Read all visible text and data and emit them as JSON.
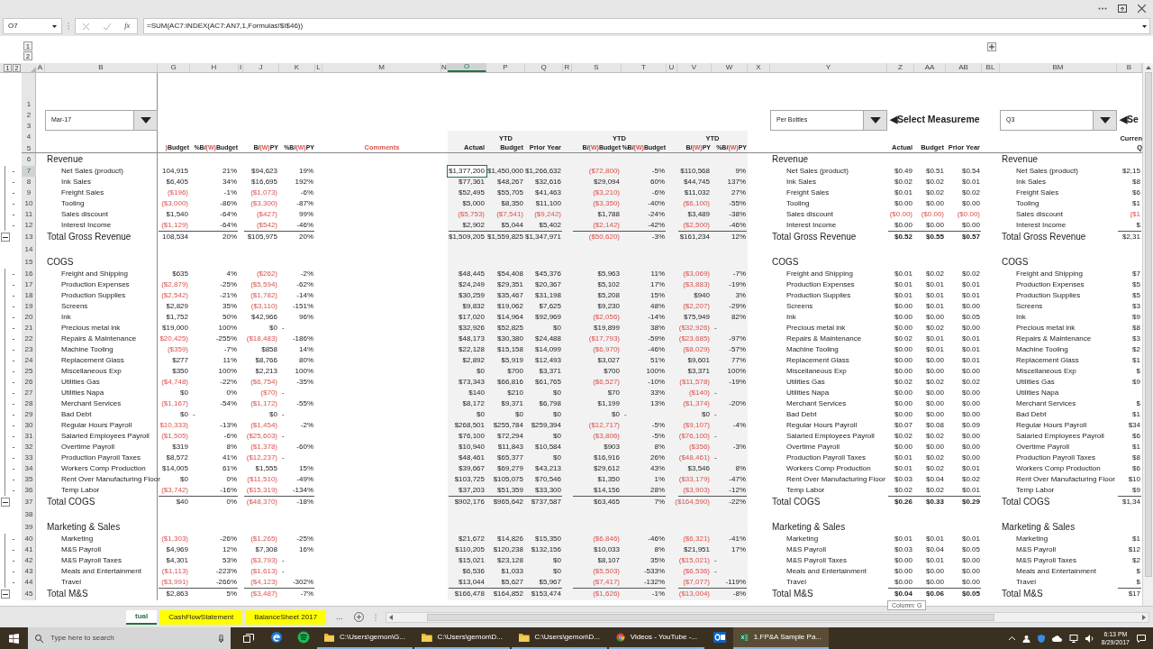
{
  "name_box": "O7",
  "function_label": "fx",
  "formula": "=SUM(AC7:INDEX(AC7:AN7,1,Formulas!$I$46))",
  "row_outline_levels": [
    "1",
    "2"
  ],
  "column_outline_levels": [
    "1",
    "2"
  ],
  "columns": [
    {
      "label": "A",
      "selected": false
    },
    {
      "label": "B",
      "selected": false
    },
    {
      "label": "G",
      "selected": false
    },
    {
      "label": "H",
      "selected": false
    },
    {
      "label": "I",
      "selected": false
    },
    {
      "label": "J",
      "selected": false
    },
    {
      "label": "K",
      "selected": false
    },
    {
      "label": "L",
      "selected": false
    },
    {
      "label": "M",
      "selected": false
    },
    {
      "label": "N",
      "selected": false
    },
    {
      "label": "O",
      "selected": true
    },
    {
      "label": "P",
      "selected": false
    },
    {
      "label": "Q",
      "selected": false
    },
    {
      "label": "R",
      "selected": false
    },
    {
      "label": "S",
      "selected": false
    },
    {
      "label": "T",
      "selected": false
    },
    {
      "label": "U",
      "selected": false
    },
    {
      "label": "V",
      "selected": false
    },
    {
      "label": "W",
      "selected": false
    },
    {
      "label": "X",
      "selected": false
    },
    {
      "label": "Y",
      "selected": false
    },
    {
      "label": "Z",
      "selected": false
    },
    {
      "label": "AA",
      "selected": false
    },
    {
      "label": "AB",
      "selected": false
    },
    {
      "label": "BL",
      "selected": false
    },
    {
      "label": "BM",
      "selected": false
    },
    {
      "label": "B",
      "selected": false
    }
  ],
  "filters": {
    "period": "Mar-17",
    "measure": "Per Bottles",
    "measure_hint": "◀Select Measureme",
    "quarter": "Q3",
    "quarter_hint": "◀Se"
  },
  "top_row_numbers": [
    "1",
    "2",
    "3",
    "4",
    "5"
  ],
  "header": {
    "ytd_labels": [
      "YTD",
      "YTD",
      "YTD"
    ],
    "quarter_top": "Curren",
    "month_columns": [
      [
        {
          "t": ")",
          "red": true
        },
        {
          "t": " Budget"
        }
      ],
      [
        {
          "t": "%B/"
        },
        {
          "t": "(W)",
          "red": true
        },
        {
          "t": " Budget"
        }
      ],
      [
        {
          "t": "B/"
        },
        {
          "t": "(W)",
          "red": true
        },
        {
          "t": " PY"
        }
      ],
      [
        {
          "t": "%B/"
        },
        {
          "t": "(W)",
          "red": true
        },
        {
          "t": " PY"
        }
      ]
    ],
    "comments": "Comments",
    "ytd_columns": [
      "Actual",
      "Budget",
      "Prior Year"
    ],
    "variance_columns": [
      [
        {
          "t": "B/"
        },
        {
          "t": "(W)",
          "red": true
        },
        {
          "t": " Budget"
        }
      ],
      [
        {
          "t": "%B/"
        },
        {
          "t": "(W)",
          "red": true
        },
        {
          "t": " Budget"
        }
      ],
      [
        {
          "t": "B/"
        },
        {
          "t": "(W)",
          "red": true
        },
        {
          "t": " PY"
        }
      ],
      [
        {
          "t": "%B/"
        },
        {
          "t": "(W)",
          "red": true
        },
        {
          "t": " PY"
        }
      ]
    ],
    "per_unit_columns": [
      "Actual",
      "Budget",
      "Prior Year"
    ],
    "quarter_column": "Q"
  },
  "rows": [
    {
      "n": "6",
      "kind": "section",
      "labels": [
        "Revenue",
        "Revenue",
        "Revenue"
      ]
    },
    {
      "n": "7",
      "kind": "item",
      "labels": [
        "Net Sales (product)",
        "Net Sales (product)",
        "Net Sales (product)"
      ],
      "month": [
        "104,915",
        "21%",
        "$94,623",
        "19%"
      ],
      "ytd": [
        "$1,377,200",
        "$1,450,000",
        "$1,266,632"
      ],
      "ytd_selected": [
        true,
        false,
        false
      ],
      "variance": [
        {
          "v": "($72,800)",
          "neg": true
        },
        "-5%",
        "$110,568",
        "9%"
      ],
      "per_unit": [
        "$0.49",
        "$0.51",
        "$0.54"
      ],
      "quarter": "$2,15"
    },
    {
      "n": "8",
      "kind": "item",
      "labels": [
        "Ink Sales",
        "Ink Sales",
        "Ink Sales"
      ],
      "month": [
        "$6,405",
        "34%",
        "$16,695",
        "192%"
      ],
      "ytd": [
        "$77,361",
        "$48,267",
        "$32,616"
      ],
      "variance": [
        "$29,094",
        "60%",
        "$44,745",
        "137%"
      ],
      "per_unit": [
        "$0.02",
        "$0.02",
        "$0.01"
      ],
      "quarter": "$8"
    },
    {
      "n": "9",
      "kind": "item",
      "labels": [
        "Freight Sales",
        "Freight Sales",
        "Freight Sales"
      ],
      "month": [
        {
          "v": "($196)",
          "neg": true
        },
        "-1%",
        {
          "v": "($1,073)",
          "neg": true
        },
        "-6%"
      ],
      "ytd": [
        "$52,495",
        "$55,705",
        "$41,463"
      ],
      "variance": [
        {
          "v": "($3,210)",
          "neg": true
        },
        "-6%",
        "$11,032",
        "27%"
      ],
      "per_unit": [
        "$0.01",
        "$0.02",
        "$0.02"
      ],
      "quarter": "$6"
    },
    {
      "n": "10",
      "kind": "item",
      "labels": [
        "Tooling",
        "Tooling",
        "Tooling"
      ],
      "month": [
        {
          "v": "($3,000)",
          "neg": true
        },
        "-86%",
        {
          "v": "($3,300)",
          "neg": true
        },
        "-87%"
      ],
      "ytd": [
        "$5,000",
        "$8,350",
        "$11,100"
      ],
      "variance": [
        {
          "v": "($3,350)",
          "neg": true
        },
        "-40%",
        {
          "v": "($6,100)",
          "neg": true
        },
        "-55%"
      ],
      "per_unit": [
        "$0.00",
        "$0.00",
        "$0.00"
      ],
      "quarter": "$1"
    },
    {
      "n": "11",
      "kind": "item",
      "labels": [
        "Sales discount",
        "Sales discount",
        "Sales discount"
      ],
      "month": [
        "$1,540",
        "-64%",
        {
          "v": "($427)",
          "neg": true
        },
        "99%"
      ],
      "ytd": [
        {
          "v": "($5,753)",
          "neg": true
        },
        {
          "v": "($7,541)",
          "neg": true
        },
        {
          "v": "($9,242)",
          "neg": true
        }
      ],
      "variance": [
        "$1,788",
        "-24%",
        "$3,489",
        "-38%"
      ],
      "per_unit": [
        {
          "v": "($0.00)",
          "neg": true
        },
        {
          "v": "($0.00)",
          "neg": true
        },
        {
          "v": "($0.00)",
          "neg": true
        }
      ],
      "quarter": {
        "v": "($1",
        "neg": true
      }
    },
    {
      "n": "12",
      "kind": "item",
      "labels": [
        "Interest Income",
        "Interest Income",
        "Interest Income"
      ],
      "month": [
        {
          "v": "($1,129)",
          "neg": true
        },
        "-64%",
        {
          "v": "($542)",
          "neg": true
        },
        "-46%"
      ],
      "ytd": [
        "$2,902",
        "$5,044",
        "$5,402"
      ],
      "variance": [
        {
          "v": "($2,142)",
          "neg": true
        },
        "-42%",
        {
          "v": "($2,500)",
          "neg": true
        },
        "-46%"
      ],
      "per_unit": [
        "$0.00",
        "$0.00",
        "$0.00"
      ],
      "quarter": "$"
    },
    {
      "n": "13",
      "kind": "total",
      "labels": [
        "Total Gross Revenue",
        "Total Gross Revenue",
        "Total Gross Revenue"
      ],
      "month": [
        "108,534",
        "20%",
        "$105,975",
        "20%"
      ],
      "ytd": [
        "$1,509,205",
        "$1,559,825",
        "$1,347,971"
      ],
      "variance": [
        {
          "v": "($50,620)",
          "neg": true
        },
        "-3%",
        "$161,234",
        "12%"
      ],
      "per_unit": [
        "$0.52",
        "$0.55",
        "$0.57"
      ],
      "quarter": "$2,31"
    },
    {
      "n": "14",
      "kind": "blank"
    },
    {
      "n": "15",
      "kind": "section",
      "labels": [
        "COGS",
        "COGS",
        "COGS"
      ]
    },
    {
      "n": "16",
      "kind": "item",
      "labels": [
        "Freight and Shipping",
        "Freight and Shipping",
        "Freight and Shipping"
      ],
      "month": [
        "$635",
        "4%",
        {
          "v": "($262)",
          "neg": true
        },
        "-2%"
      ],
      "ytd": [
        "$48,445",
        "$54,408",
        "$45,376"
      ],
      "variance": [
        "$5,963",
        "11%",
        {
          "v": "($3,069)",
          "neg": true
        },
        "-7%"
      ],
      "per_unit": [
        "$0.01",
        "$0.02",
        "$0.02"
      ],
      "quarter": "$7"
    },
    {
      "n": "17",
      "kind": "item",
      "labels": [
        "Production Expenses",
        "Production Expenses",
        "Production Expenses"
      ],
      "month": [
        {
          "v": "($2,879)",
          "neg": true
        },
        "-25%",
        {
          "v": "($5,594)",
          "neg": true
        },
        "-62%"
      ],
      "ytd": [
        "$24,249",
        "$29,351",
        "$20,367"
      ],
      "variance": [
        "$5,102",
        "17%",
        {
          "v": "($3,883)",
          "neg": true
        },
        "-19%"
      ],
      "per_unit": [
        "$0.01",
        "$0.01",
        "$0.01"
      ],
      "quarter": "$5"
    },
    {
      "n": "18",
      "kind": "item",
      "labels": [
        "Production Supplies",
        "Production Supplies",
        "Production Supplies"
      ],
      "month": [
        {
          "v": "($2,542)",
          "neg": true
        },
        "-21%",
        {
          "v": "($1,782)",
          "neg": true
        },
        "-14%"
      ],
      "ytd": [
        "$30,259",
        "$35,467",
        "$31,198"
      ],
      "variance": [
        "$5,208",
        "15%",
        "$940",
        "3%"
      ],
      "per_unit": [
        "$0.01",
        "$0.01",
        "$0.01"
      ],
      "quarter": "$5"
    },
    {
      "n": "19",
      "kind": "item",
      "labels": [
        "Screens",
        "Screens",
        "Screens"
      ],
      "month": [
        "$2,829",
        "35%",
        {
          "v": "($3,110)",
          "neg": true
        },
        "-151%"
      ],
      "ytd": [
        "$9,832",
        "$19,062",
        "$7,625"
      ],
      "variance": [
        "$9,230",
        "48%",
        {
          "v": "($2,207)",
          "neg": true
        },
        "-29%"
      ],
      "per_unit": [
        "$0.00",
        "$0.01",
        "$0.00"
      ],
      "quarter": "$3"
    },
    {
      "n": "20",
      "kind": "item",
      "labels": [
        "Ink",
        "Ink",
        "Ink"
      ],
      "month": [
        "$1,752",
        "50%",
        "$42,966",
        "96%"
      ],
      "ytd": [
        "$17,020",
        "$14,964",
        "$92,969"
      ],
      "variance": [
        {
          "v": "($2,056)",
          "neg": true
        },
        "-14%",
        "$75,949",
        "82%"
      ],
      "per_unit": [
        "$0.00",
        "$0.00",
        "$0.05"
      ],
      "quarter": "$9"
    },
    {
      "n": "21",
      "kind": "item",
      "labels": [
        "Precious metal ink",
        "Precious metal ink",
        "Precious metal ink"
      ],
      "month": [
        "$19,000",
        "100%",
        "$0",
        {
          "v": "-",
          "kind": "dash"
        }
      ],
      "ytd": [
        "$32,926",
        "$52,825",
        "$0"
      ],
      "variance": [
        "$19,899",
        "38%",
        {
          "v": "($32,926)",
          "neg": true
        },
        {
          "v": "-",
          "kind": "dash"
        }
      ],
      "per_unit": [
        "$0.00",
        "$0.02",
        "$0.00"
      ],
      "quarter": "$8"
    },
    {
      "n": "22",
      "kind": "item",
      "labels": [
        "Repairs & Maintenance",
        "Repairs & Maintenance",
        "Repairs & Maintenance"
      ],
      "month": [
        {
          "v": "$20,425)",
          "neg": true
        },
        "-255%",
        {
          "v": "($18,483)",
          "neg": true
        },
        "-186%"
      ],
      "ytd": [
        "$48,173",
        "$30,380",
        "$24,488"
      ],
      "variance": [
        {
          "v": "($17,793)",
          "neg": true
        },
        "-59%",
        {
          "v": "($23,685)",
          "neg": true
        },
        "-97%"
      ],
      "per_unit": [
        "$0.02",
        "$0.01",
        "$0.01"
      ],
      "quarter": "$3"
    },
    {
      "n": "23",
      "kind": "item",
      "labels": [
        "Machine Tooling",
        "Machine Tooling",
        "Machine Tooling"
      ],
      "month": [
        {
          "v": "($359)",
          "neg": true
        },
        "-7%",
        "$858",
        "14%"
      ],
      "ytd": [
        "$22,128",
        "$15,158",
        "$14,099"
      ],
      "variance": [
        {
          "v": "($6,970)",
          "neg": true
        },
        "-46%",
        {
          "v": "($8,029)",
          "neg": true
        },
        "-57%"
      ],
      "per_unit": [
        "$0.00",
        "$0.01",
        "$0.01"
      ],
      "quarter": "$2"
    },
    {
      "n": "24",
      "kind": "item",
      "labels": [
        "Replacement Glass",
        "Replacement Glass",
        "Replacement Glass"
      ],
      "month": [
        "$277",
        "11%",
        "$8,766",
        "80%"
      ],
      "ytd": [
        "$2,892",
        "$5,919",
        "$12,493"
      ],
      "variance": [
        "$3,027",
        "51%",
        "$9,601",
        "77%"
      ],
      "per_unit": [
        "$0.00",
        "$0.00",
        "$0.01"
      ],
      "quarter": "$1"
    },
    {
      "n": "25",
      "kind": "item",
      "labels": [
        "Miscellaneous Exp",
        "Miscellaneous Exp",
        "Miscellaneous Exp"
      ],
      "month": [
        "$350",
        "100%",
        "$2,213",
        "100%"
      ],
      "ytd": [
        "$0",
        "$700",
        "$3,371"
      ],
      "variance": [
        "$700",
        "100%",
        "$3,371",
        "100%"
      ],
      "per_unit": [
        "$0.00",
        "$0.00",
        "$0.00"
      ],
      "quarter": "$"
    },
    {
      "n": "26",
      "kind": "item",
      "labels": [
        "Utilities Gas",
        "Utilities Gas",
        "Utilities Gas"
      ],
      "month": [
        {
          "v": "($4,748)",
          "neg": true
        },
        "-22%",
        {
          "v": "($6,754)",
          "neg": true
        },
        "-35%"
      ],
      "ytd": [
        "$73,343",
        "$66,816",
        "$61,765"
      ],
      "variance": [
        {
          "v": "($6,527)",
          "neg": true
        },
        "-10%",
        {
          "v": "($11,578)",
          "neg": true
        },
        "-19%"
      ],
      "per_unit": [
        "$0.02",
        "$0.02",
        "$0.02"
      ],
      "quarter": "$9"
    },
    {
      "n": "27",
      "kind": "item",
      "labels": [
        "Utilities Napa",
        "Utilities Napa",
        "Utilities Napa"
      ],
      "month": [
        "$0",
        "0%",
        {
          "v": "($70)",
          "neg": true
        },
        {
          "v": "-",
          "kind": "dash"
        }
      ],
      "ytd": [
        "$140",
        "$210",
        "$0"
      ],
      "variance": [
        "$70",
        "33%",
        {
          "v": "($140)",
          "neg": true
        },
        {
          "v": "-",
          "kind": "dash"
        }
      ],
      "per_unit": [
        "$0.00",
        "$0.00",
        "$0.00"
      ]
    },
    {
      "n": "28",
      "kind": "item",
      "labels": [
        "Merchant Services",
        "Merchant Services",
        "Merchant Services"
      ],
      "month": [
        {
          "v": "($1,167)",
          "neg": true
        },
        "-54%",
        {
          "v": "($1,172)",
          "neg": true
        },
        "-55%"
      ],
      "ytd": [
        "$8,172",
        "$9,371",
        "$6,798"
      ],
      "variance": [
        "$1,199",
        "13%",
        {
          "v": "($1,374)",
          "neg": true
        },
        "-20%"
      ],
      "per_unit": [
        "$0.00",
        "$0.00",
        "$0.00"
      ],
      "quarter": "$"
    },
    {
      "n": "29",
      "kind": "item",
      "labels": [
        "Bad Debt",
        "Bad Debt",
        "Bad Debt"
      ],
      "month": [
        "$0",
        {
          "v": "-",
          "kind": "dash"
        },
        "$0",
        {
          "v": "-",
          "kind": "dash"
        }
      ],
      "ytd": [
        "$0",
        "$0",
        "$0"
      ],
      "variance": [
        "$0",
        {
          "v": "-",
          "kind": "dash"
        },
        "$0",
        {
          "v": "-",
          "kind": "dash"
        }
      ],
      "per_unit": [
        "$0.00",
        "$0.00",
        "$0.00"
      ],
      "quarter": "$1"
    },
    {
      "n": "30",
      "kind": "item",
      "labels": [
        "Regular Hours Payroll",
        "Regular Hours Payroll",
        "Regular Hours Payroll"
      ],
      "month": [
        {
          "v": "$10,333)",
          "neg": true
        },
        "-13%",
        {
          "v": "($1,454)",
          "neg": true
        },
        "-2%"
      ],
      "ytd": [
        "$268,501",
        "$255,784",
        "$259,394"
      ],
      "variance": [
        {
          "v": "($12,717)",
          "neg": true
        },
        "-5%",
        {
          "v": "($9,107)",
          "neg": true
        },
        "-4%"
      ],
      "per_unit": [
        "$0.07",
        "$0.08",
        "$0.09"
      ],
      "quarter": "$34"
    },
    {
      "n": "31",
      "kind": "item",
      "labels": [
        "Salaried Employees Payroll",
        "Salaried Employees Payroll",
        "Salaried Employees Payroll"
      ],
      "month": [
        {
          "v": "($1,505)",
          "neg": true
        },
        "-6%",
        {
          "v": "($25,603)",
          "neg": true
        },
        {
          "v": "-",
          "kind": "dash"
        }
      ],
      "ytd": [
        "$76,100",
        "$72,294",
        "$0"
      ],
      "variance": [
        {
          "v": "($3,806)",
          "neg": true
        },
        "-5%",
        {
          "v": "($76,100)",
          "neg": true
        },
        {
          "v": "-",
          "kind": "dash"
        }
      ],
      "per_unit": [
        "$0.02",
        "$0.02",
        "$0.00"
      ],
      "quarter": "$6"
    },
    {
      "n": "32",
      "kind": "item",
      "labels": [
        "Overtime Payroll",
        "Overtime Payroll",
        "Overtime Payroll"
      ],
      "month": [
        "$319",
        "8%",
        {
          "v": "($1,378)",
          "neg": true
        },
        "-60%"
      ],
      "ytd": [
        "$10,940",
        "$11,843",
        "$10,584"
      ],
      "variance": [
        "$903",
        "8%",
        {
          "v": "($356)",
          "neg": true
        },
        "-3%"
      ],
      "per_unit": [
        "$0.00",
        "$0.00",
        "$0.00"
      ],
      "quarter": "$1"
    },
    {
      "n": "33",
      "kind": "item",
      "labels": [
        "Production Payroll Taxes",
        "Production Payroll Taxes",
        "Production Payroll Taxes"
      ],
      "month": [
        "$8,572",
        "41%",
        {
          "v": "($12,237)",
          "neg": true
        },
        {
          "v": "-",
          "kind": "dash"
        }
      ],
      "ytd": [
        "$48,461",
        "$65,377",
        "$0"
      ],
      "variance": [
        "$16,916",
        "26%",
        {
          "v": "($48,461)",
          "neg": true
        },
        {
          "v": "-",
          "kind": "dash"
        }
      ],
      "per_unit": [
        "$0.01",
        "$0.02",
        "$0.00"
      ],
      "quarter": "$8"
    },
    {
      "n": "34",
      "kind": "item",
      "labels": [
        "Workers Comp Production",
        "Workers Comp Production",
        "Workers Comp Production"
      ],
      "month": [
        "$14,005",
        "61%",
        "$1,555",
        "15%"
      ],
      "ytd": [
        "$39,667",
        "$69,279",
        "$43,213"
      ],
      "variance": [
        "$29,612",
        "43%",
        "$3,546",
        "8%"
      ],
      "per_unit": [
        "$0.01",
        "$0.02",
        "$0.01"
      ],
      "quarter": "$6"
    },
    {
      "n": "35",
      "kind": "item",
      "labels": [
        "Rent Over Manufacturing Floor",
        "Rent Over Manufacturing Floor",
        "Rent Over Manufacturing Floor"
      ],
      "month": [
        "$0",
        "0%",
        {
          "v": "($11,510)",
          "neg": true
        },
        "-49%"
      ],
      "ytd": [
        "$103,725",
        "$105,075",
        "$70,546"
      ],
      "variance": [
        "$1,350",
        "1%",
        {
          "v": "($33,179)",
          "neg": true
        },
        "-47%"
      ],
      "per_unit": [
        "$0.03",
        "$0.04",
        "$0.02"
      ],
      "quarter": "$10"
    },
    {
      "n": "36",
      "kind": "item",
      "labels": [
        "Temp Labor",
        "Temp Labor",
        "Temp Labor"
      ],
      "month": [
        {
          "v": "($3,742)",
          "neg": true
        },
        "-16%",
        {
          "v": "($15,319)",
          "neg": true
        },
        "-134%"
      ],
      "ytd": [
        "$37,203",
        "$51,359",
        "$33,300"
      ],
      "variance": [
        "$14,156",
        "28%",
        {
          "v": "($3,903)",
          "neg": true
        },
        "-12%"
      ],
      "per_unit": [
        "$0.02",
        "$0.02",
        "$0.01"
      ],
      "quarter": "$9"
    },
    {
      "n": "37",
      "kind": "total",
      "labels": [
        "Total COGS",
        "Total COGS",
        "Total COGS"
      ],
      "month": [
        "$40",
        "0%",
        {
          "v": "($48,370)",
          "neg": true
        },
        "-18%"
      ],
      "ytd": [
        "$902,176",
        "$965,642",
        "$737,587"
      ],
      "variance": [
        "$63,465",
        "7%",
        {
          "v": "($164,590)",
          "neg": true
        },
        "-22%"
      ],
      "per_unit": [
        "$0.26",
        "$0.33",
        "$0.29"
      ],
      "quarter": "$1,34"
    },
    {
      "n": "38",
      "kind": "blank"
    },
    {
      "n": "39",
      "kind": "section",
      "labels": [
        "Marketing & Sales",
        "Marketing & Sales",
        "Marketing & Sales"
      ]
    },
    {
      "n": "40",
      "kind": "item",
      "labels": [
        "Marketing",
        "Marketing",
        "Marketing"
      ],
      "month": [
        {
          "v": "($1,303)",
          "neg": true
        },
        "-26%",
        {
          "v": "($1,265)",
          "neg": true
        },
        "-25%"
      ],
      "ytd": [
        "$21,672",
        "$14,826",
        "$15,350"
      ],
      "variance": [
        {
          "v": "($6,846)",
          "neg": true
        },
        "-46%",
        {
          "v": "($6,321)",
          "neg": true
        },
        "-41%"
      ],
      "per_unit": [
        "$0.01",
        "$0.01",
        "$0.01"
      ],
      "quarter": "$1"
    },
    {
      "n": "41",
      "kind": "item",
      "labels": [
        "M&S Payroll",
        "M&S Payroll",
        "M&S Payroll"
      ],
      "month": [
        "$4,969",
        "12%",
        "$7,308",
        "16%"
      ],
      "ytd": [
        "$110,205",
        "$120,238",
        "$132,156"
      ],
      "variance": [
        "$10,033",
        "8%",
        "$21,951",
        "17%"
      ],
      "per_unit": [
        "$0.03",
        "$0.04",
        "$0.05"
      ],
      "quarter": "$12"
    },
    {
      "n": "42",
      "kind": "item",
      "labels": [
        "M&S Payroll Taxes",
        "M&S Payroll Taxes",
        "M&S Payroll Taxes"
      ],
      "month": [
        "$4,301",
        "53%",
        {
          "v": "($3,793)",
          "neg": true
        },
        {
          "v": "-",
          "kind": "dash"
        }
      ],
      "ytd": [
        "$15,021",
        "$23,128",
        "$0"
      ],
      "variance": [
        "$8,107",
        "35%",
        {
          "v": "($15,021)",
          "neg": true
        },
        {
          "v": "-",
          "kind": "dash"
        }
      ],
      "per_unit": [
        "$0.00",
        "$0.01",
        "$0.00"
      ],
      "quarter": "$2"
    },
    {
      "n": "43",
      "kind": "item",
      "labels": [
        "Meals and Entertainment",
        "Meals and Entertainment",
        "Meals and Entertainment"
      ],
      "month": [
        {
          "v": "($1,113)",
          "neg": true
        },
        "-223%",
        {
          "v": "($1,613)",
          "neg": true
        },
        {
          "v": "-",
          "kind": "dash"
        }
      ],
      "ytd": [
        "$6,536",
        "$1,033",
        "$0"
      ],
      "variance": [
        {
          "v": "($5,503)",
          "neg": true
        },
        "-533%",
        {
          "v": "($6,536)",
          "neg": true
        },
        {
          "v": "-",
          "kind": "dash"
        }
      ],
      "per_unit": [
        "$0.00",
        "$0.00",
        "$0.00"
      ],
      "quarter": "$"
    },
    {
      "n": "44",
      "kind": "item",
      "labels": [
        "Travel",
        "Travel",
        "Travel"
      ],
      "month": [
        {
          "v": "($3,991)",
          "neg": true
        },
        "-266%",
        {
          "v": "($4,123)",
          "neg": true
        },
        "-302%"
      ],
      "ytd": [
        "$13,044",
        "$5,627",
        "$5,967"
      ],
      "variance": [
        {
          "v": "($7,417)",
          "neg": true
        },
        "-132%",
        {
          "v": "($7,077)",
          "neg": true
        },
        "-119%"
      ],
      "per_unit": [
        "$0.00",
        "$0.00",
        "$0.00"
      ],
      "quarter": "$"
    },
    {
      "n": "45",
      "kind": "total",
      "labels": [
        "Total M&S",
        "Total M&S",
        "Total M&S"
      ],
      "month": [
        "$2,863",
        "5%",
        {
          "v": "($3,487)",
          "neg": true
        },
        "-7%"
      ],
      "ytd": [
        "$166,478",
        "$164,852",
        "$153,474"
      ],
      "variance": [
        {
          "v": "($1,626)",
          "neg": true
        },
        "-1%",
        {
          "v": "($13,004)",
          "neg": true
        },
        "-8%"
      ],
      "per_unit": [
        "$0.04",
        "$0.06",
        "$0.05"
      ],
      "quarter": "$17"
    }
  ],
  "tooltip": "Column: G",
  "sheet_tabs": [
    {
      "label": "tual",
      "selected": true
    },
    {
      "label": "CashFlowStatement",
      "selected": false,
      "color": "#ffff00"
    },
    {
      "label": "BalanceSheet 2017",
      "selected": false,
      "color": "#ffff00"
    }
  ],
  "more_sheets": "...",
  "taskbar": {
    "search_placeholder": "Type here to search",
    "time": "6:13 PM",
    "date": "8/29/2017",
    "apps": [
      {
        "kind": "edge",
        "selected": false
      },
      {
        "kind": "music",
        "selected": false
      },
      {
        "kind": "folder",
        "label": "C:\\Users\\gemon\\G...",
        "selected": false
      },
      {
        "kind": "folder",
        "label": "C:\\Users\\gemon\\D...",
        "selected": false
      },
      {
        "kind": "folder",
        "label": "C:\\Users\\gemon\\D...",
        "selected": false
      },
      {
        "kind": "browser",
        "label": "Videos - YouTube -...",
        "selected": false
      },
      {
        "kind": "mail",
        "selected": false
      },
      {
        "kind": "spreadsheet",
        "label": "1.FP&A Sample Pa...",
        "selected": true
      }
    ]
  }
}
